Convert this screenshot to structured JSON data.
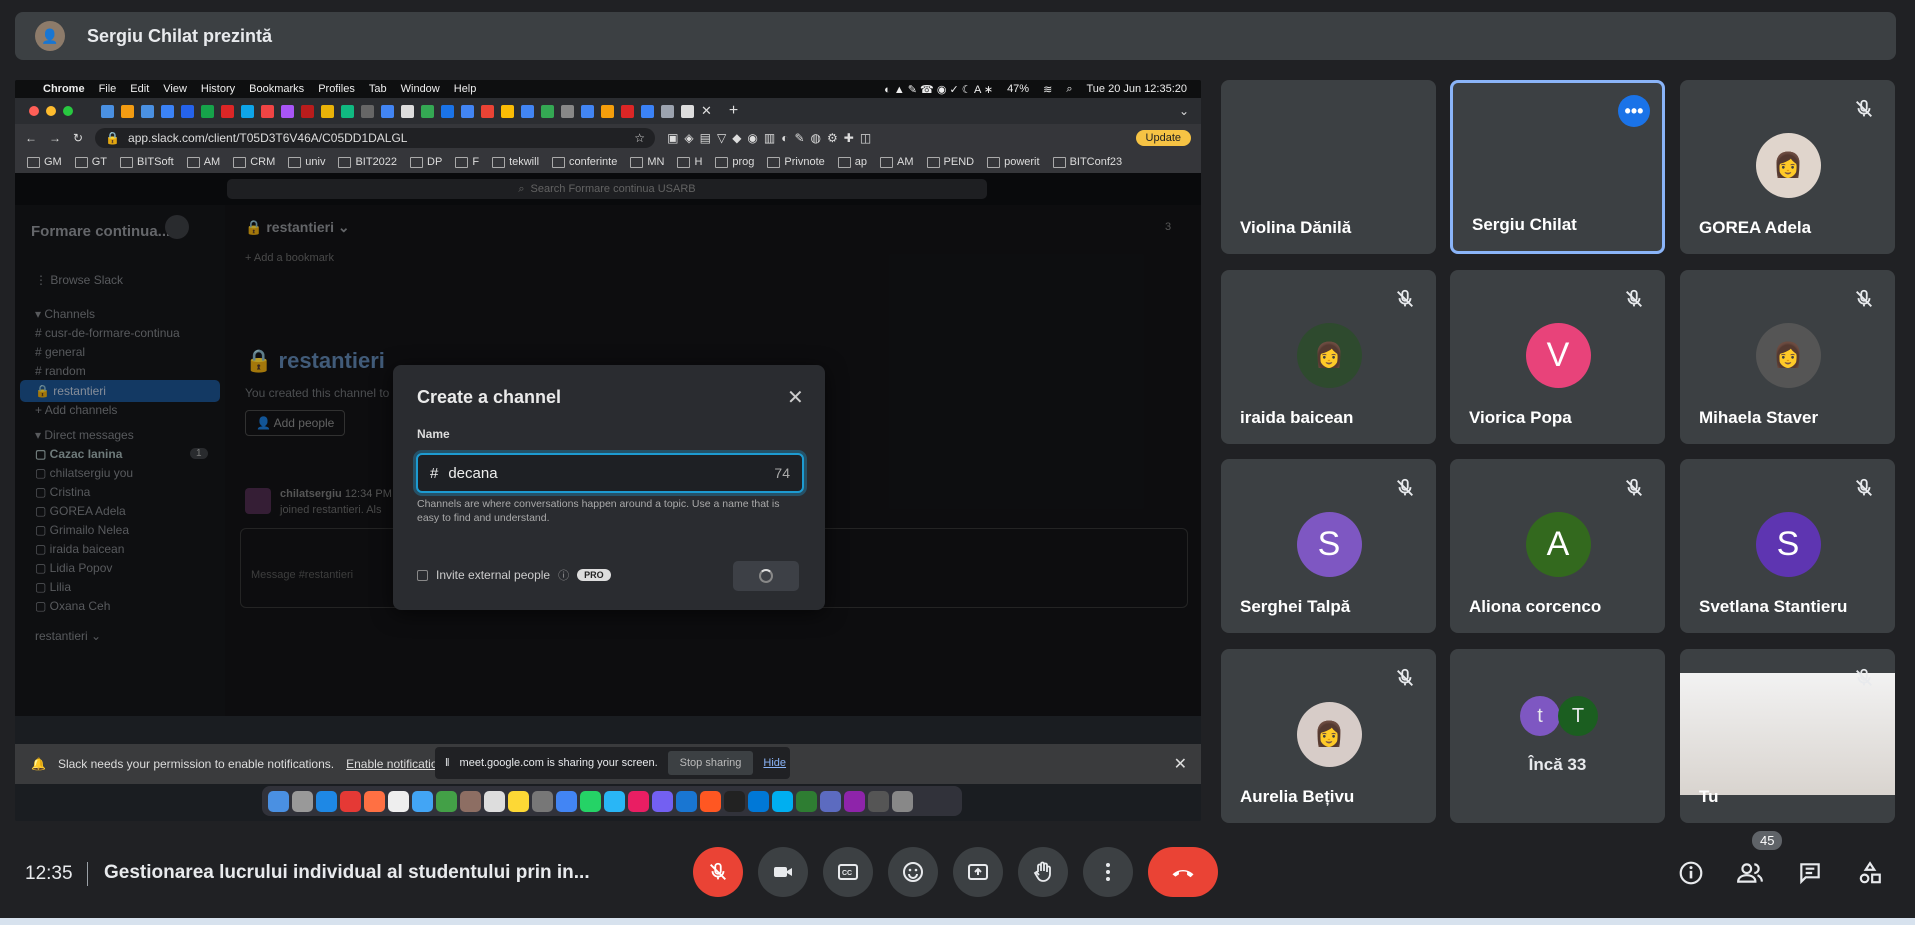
{
  "top_bar": {
    "presenter_title": "Sergiu Chilat prezintă"
  },
  "mac_menu": {
    "items": [
      "Chrome",
      "File",
      "Edit",
      "View",
      "History",
      "Bookmarks",
      "Profiles",
      "Tab",
      "Window",
      "Help"
    ],
    "battery": "47%",
    "datetime": "Tue 20 Jun  12:35:20"
  },
  "browser": {
    "url": "app.slack.com/client/T05D3T6V46A/C05DD1DALGL",
    "update_label": "Update",
    "bookmarks": [
      "GM",
      "GT",
      "BITSoft",
      "AM",
      "CRM",
      "univ",
      "BIT2022",
      "DP",
      "F",
      "tekwill",
      "conferinte",
      "MN",
      "H",
      "prog",
      "Privnote",
      "ap",
      "AM",
      "PEND",
      "powerit",
      "BITConf23"
    ]
  },
  "slack": {
    "search_placeholder": "Search Formare continua USARB",
    "workspace": "Formare continua...",
    "browse": "Browse Slack",
    "channels_header": "Channels",
    "channels": [
      "cusr-de-formare-continua",
      "general",
      "random",
      "restantieri"
    ],
    "add_channels": "Add channels",
    "dm_header": "Direct messages",
    "dms": [
      "Cazac Ianina",
      "chilatsergiu  you",
      "Cristina",
      "GOREA Adela",
      "Grimailo Nelea",
      "iraida baicean",
      "Lidia Popov",
      "Lilia",
      "Oxana Ceh"
    ],
    "dm_badge": "1",
    "footer_channel": "restantieri",
    "channel_name": "restantieri",
    "member_count": "3",
    "add_bookmark": "+ Add a bookmark",
    "intro_title": "restantieri",
    "intro_text": "You created this channel to",
    "add_people": "Add people",
    "msg_author": "chilatsergiu",
    "msg_time": "12:34 PM",
    "msg_text": "joined restantieri. Als",
    "composer_placeholder": "Message #restantieri"
  },
  "modal": {
    "title": "Create a channel",
    "name_label": "Name",
    "hash": "#",
    "value": "decana",
    "counter": "74",
    "help": "Channels are where conversations happen around a topic. Use a name that is easy to find and understand.",
    "invite_external": "Invite external people",
    "pro": "PRO"
  },
  "notification": {
    "text": "Slack needs your permission to enable notifications.",
    "link": "Enable notificatio"
  },
  "sharing_bar": {
    "text": "meet.google.com is sharing your screen.",
    "stop": "Stop sharing",
    "hide": "Hide"
  },
  "participants": [
    {
      "name": "Violina Dănilă",
      "kind": "video"
    },
    {
      "name": "Sergiu Chilat",
      "kind": "video",
      "active": true
    },
    {
      "name": "GOREA Adela",
      "kind": "photo"
    },
    {
      "name": "iraida baicean",
      "kind": "photo"
    },
    {
      "name": "Viorica Popa",
      "kind": "letter",
      "letter": "V",
      "color": "#e8437a"
    },
    {
      "name": "Mihaela Staver",
      "kind": "photo"
    },
    {
      "name": "Serghei Talpă",
      "kind": "letter",
      "letter": "S",
      "color": "#7e57c2"
    },
    {
      "name": "Aliona corcenco",
      "kind": "letter",
      "letter": "A",
      "color": "#33691e"
    },
    {
      "name": "Svetlana Stantieru",
      "kind": "letter",
      "letter": "S",
      "color": "#5e35b1"
    },
    {
      "name": "Aurelia Bețivu",
      "kind": "photo"
    },
    {
      "name": "Încă 33",
      "kind": "more",
      "letters": [
        "t",
        "T"
      ]
    },
    {
      "name": "Tu",
      "kind": "video"
    }
  ],
  "bottom": {
    "time": "12:35",
    "meeting_title": "Gestionarea lucrului individual al studentului prin in...",
    "people_count": "45"
  },
  "colors": {
    "accent": "#8ab4f8",
    "end_call": "#ea4335",
    "slack_selected": "#1b4f8a"
  }
}
